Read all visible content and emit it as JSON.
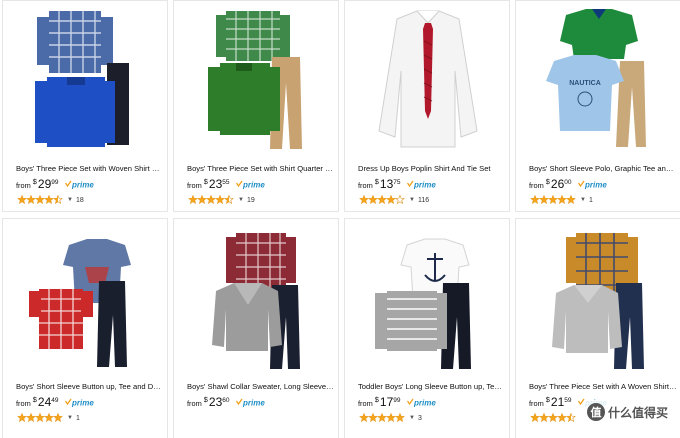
{
  "products": [
    {
      "title": "Boys' Three Piece Set with Woven Shirt Quar...",
      "from": "from",
      "currency": "$",
      "dollars": "29",
      "cents": "99",
      "prime": true,
      "stars": 4.5,
      "reviews": "18"
    },
    {
      "title": "Boys' Three Piece Set with Shirt Quarter Zip...",
      "from": "from",
      "currency": "$",
      "dollars": "23",
      "cents": "55",
      "prime": true,
      "stars": 4.5,
      "reviews": "19"
    },
    {
      "title": "Dress Up Boys Poplin Shirt And Tie Set",
      "from": "from",
      "currency": "$",
      "dollars": "13",
      "cents": "75",
      "prime": true,
      "stars": 4,
      "reviews": "116"
    },
    {
      "title": "Boys' Short Sleeve Polo, Graphic Tee and P...",
      "from": "from",
      "currency": "$",
      "dollars": "26",
      "cents": "00",
      "prime": true,
      "stars": 5,
      "reviews": "1"
    },
    {
      "title": "Boys' Short Sleeve Button up, Tee and Deni...",
      "from": "from",
      "currency": "$",
      "dollars": "24",
      "cents": "49",
      "prime": true,
      "stars": 5,
      "reviews": "1"
    },
    {
      "title": "Boys' Shawl Collar Sweater, Long Sleeve Sh...",
      "from": "from",
      "currency": "$",
      "dollars": "23",
      "cents": "60",
      "prime": true,
      "stars": null,
      "reviews": ""
    },
    {
      "title": "Toddler Boys' Long Sleeve Button up, Tee a...",
      "from": "from",
      "currency": "$",
      "dollars": "17",
      "cents": "99",
      "prime": true,
      "stars": 5,
      "reviews": "3"
    },
    {
      "title": "Boys' Three Piece Set with A Woven Shirt S...",
      "from": "from",
      "currency": "$",
      "dollars": "21",
      "cents": "59",
      "prime": true,
      "stars": 4.5,
      "reviews": ""
    }
  ],
  "prime_label": "prime",
  "watermark": {
    "badge": "值",
    "text": "什么值得买"
  },
  "colors": {
    "star": "#f4a41c",
    "prime_blue": "#1f8ec6",
    "prime_check": "#f0a11b",
    "border": "#e6e6e6"
  }
}
